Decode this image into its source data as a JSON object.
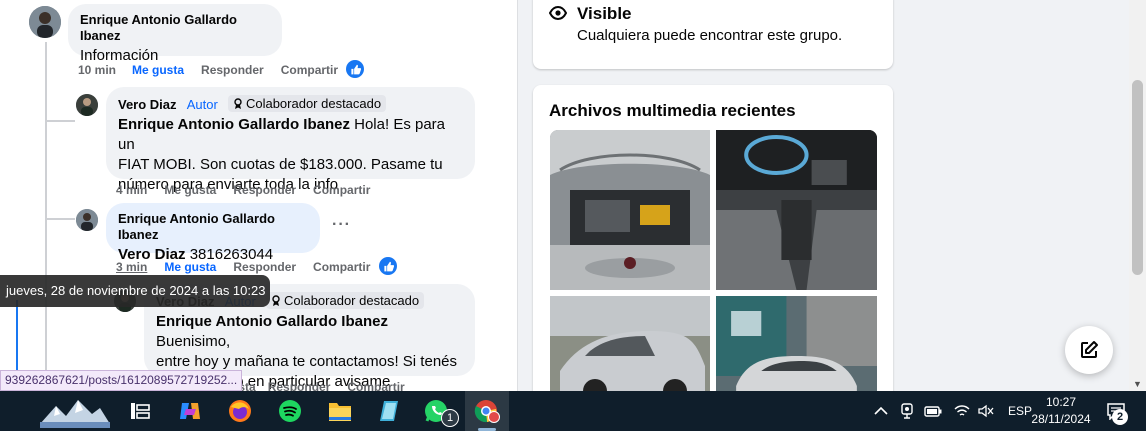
{
  "comments": [
    {
      "author": "Enrique Antonio Gallardo Ibanez",
      "text": "Información",
      "actions": {
        "time": "10 min",
        "like": "Me gusta",
        "reply": "Responder",
        "share": "Compartir"
      }
    },
    {
      "author": "Vero Diaz",
      "role": "Autor",
      "badge": "Colaborador destacado",
      "mention": "Enrique Antonio Gallardo Ibanez",
      "text_lines": [
        " Hola! Es para un",
        "FIAT MOBI. Son cuotas de $183.000. Pasame tu",
        "número para enviarte toda la info"
      ],
      "actions": {
        "time": "4 min",
        "like": "Me gusta",
        "reply": "Responder",
        "share": "Compartir"
      }
    },
    {
      "author": "Enrique Antonio Gallardo Ibanez",
      "mention": "Vero Diaz",
      "text": " 3816263044",
      "more": "···",
      "actions": {
        "time": "3 min",
        "like": "Me gusta",
        "reply": "Responder",
        "share": "Compartir"
      }
    },
    {
      "author": "Vero Diaz",
      "role": "Autor",
      "badge": "Colaborador destacado",
      "mention": "Enrique Antonio Gallardo Ibanez",
      "text_lines": [
        " Buenisimo,",
        "entre hoy y mañana te contactamos! Si tenés",
        "algún horario en particular avisame"
      ],
      "actions": {
        "time": "",
        "like": "usta",
        "reply": "Responder",
        "share": "Compartir"
      }
    }
  ],
  "tooltip": "jueves, 28 de noviembre de 2024 a las 10:23",
  "status_url": "939262867621/posts/1612089572719252...",
  "visibility": {
    "title": "Visible",
    "description": "Cualquiera puede encontrar este grupo."
  },
  "media": {
    "title": "Archivos multimedia recientes"
  },
  "taskbar": {
    "whatsapp_badge": "1",
    "language": "ESP",
    "time": "10:27",
    "date": "28/11/2024",
    "notification_count": "2"
  },
  "colors": {
    "facebook_blue": "#0866ff",
    "taskbar_bg": "#0f1e2b",
    "bubble_bg": "#f0f2f5"
  }
}
